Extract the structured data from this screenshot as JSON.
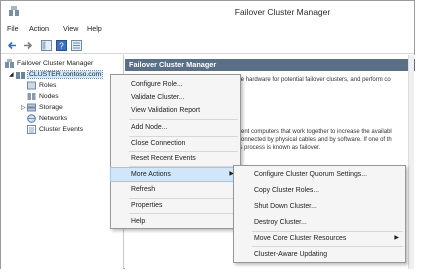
{
  "window": {
    "title": "Failover Cluster Manager"
  },
  "menubar": {
    "items": [
      "File",
      "Action",
      "View",
      "Help"
    ]
  },
  "tree": {
    "root": "Failover Cluster Manager",
    "cluster": "CLUSTER.contoso.com",
    "children": [
      "Roles",
      "Nodes",
      "Storage",
      "Networks",
      "Cluster Events"
    ]
  },
  "right_pane": {
    "header": "Failover Cluster Manager",
    "text1": "idate hardware for potential failover clusters, and perform co",
    "text2a": "endent computers that work together to increase the availabl",
    "text2b": "re connected by physical cables and by software. If one of th",
    "text2c": "This process is known as failover."
  },
  "context_menu": {
    "items": [
      "Configure Role...",
      "Validate Cluster...",
      "View Validation Report",
      "Add Node...",
      "Close Connection",
      "Reset Recent Events",
      "More Actions",
      "Refresh",
      "Properties",
      "Help"
    ]
  },
  "submenu": {
    "items": [
      "Configure Cluster Quorum Settings...",
      "Copy Cluster Roles...",
      "Shut Down Cluster...",
      "Destroy Cluster...",
      "Move Core Cluster Resources",
      "Cluster-Aware Updating"
    ]
  },
  "colors": {
    "header_bg": "#5a6f86",
    "highlight": "#cfe6fb",
    "selection": "#cde8ff"
  }
}
